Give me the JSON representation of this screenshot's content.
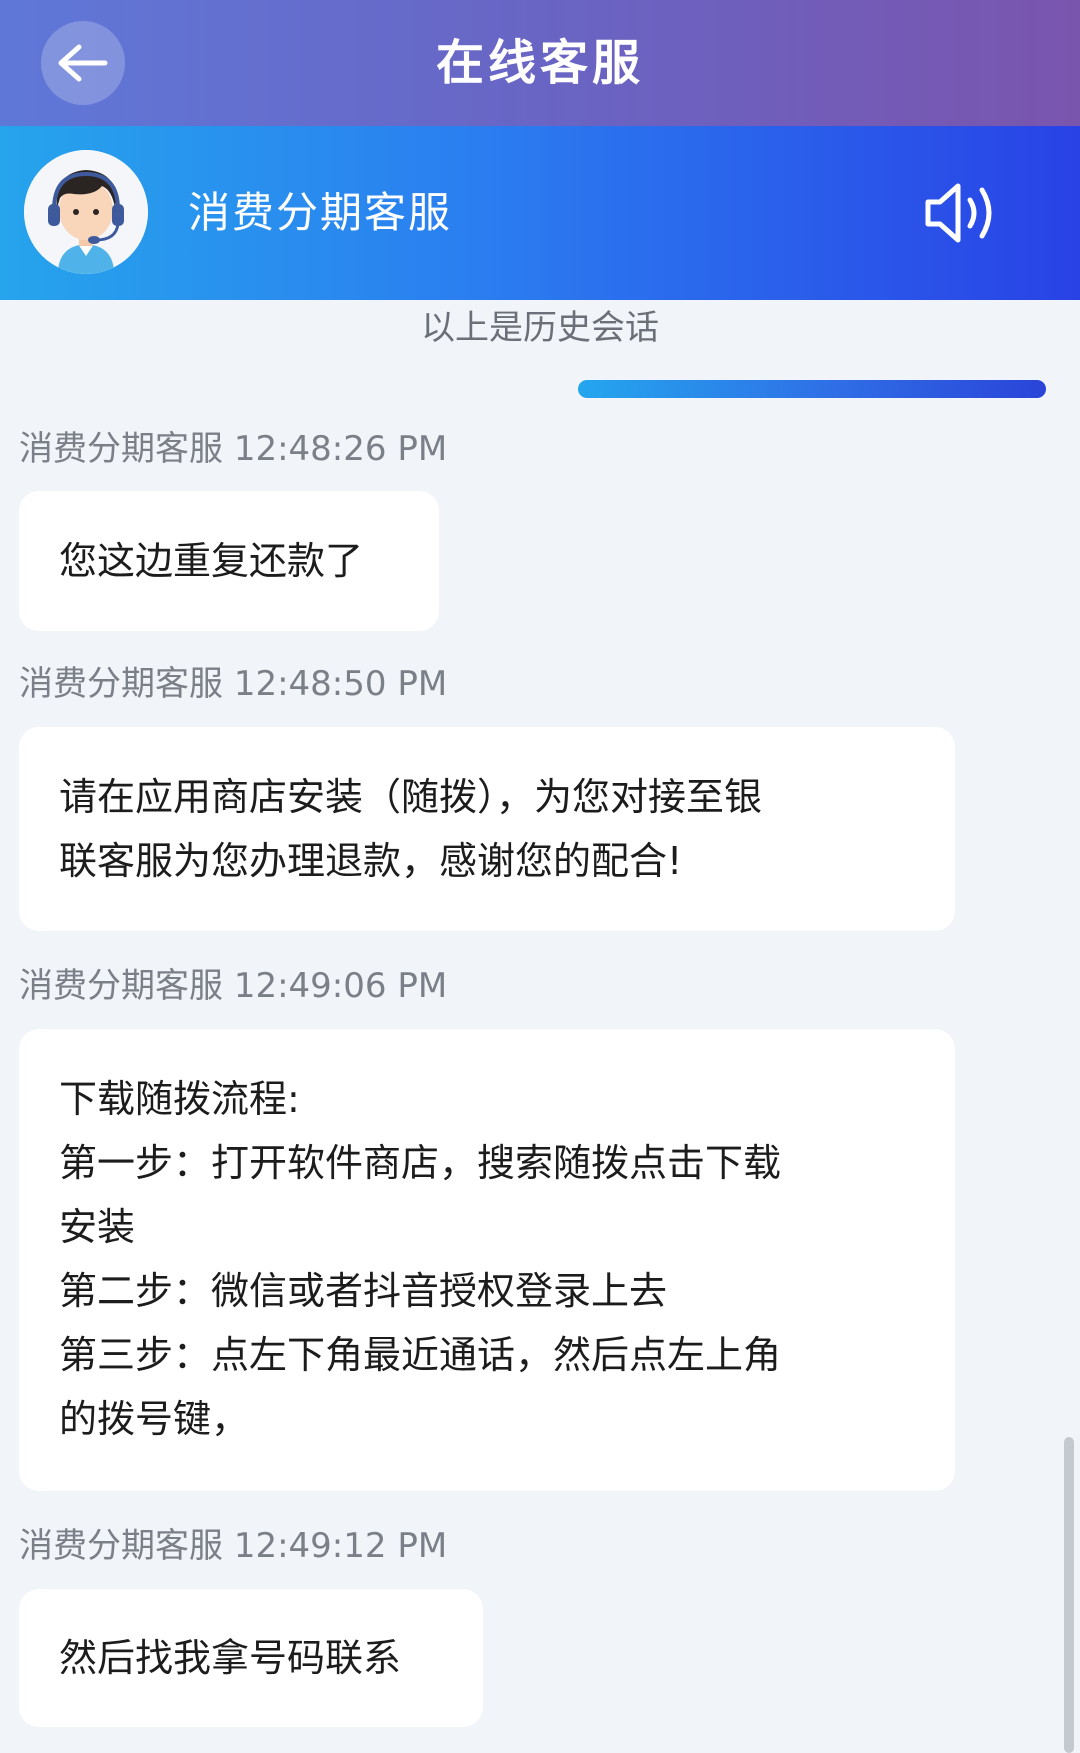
{
  "topbar": {
    "title": "在线客服",
    "back_icon": "back-arrow-icon"
  },
  "agent": {
    "name": "消费分期客服",
    "avatar_icon": "agent-headset-avatar",
    "sound_icon": "speaker-icon"
  },
  "history_note": "以上是历史会话",
  "messages": [
    {
      "sender": "消费分期客服",
      "time": "12:48:26 PM",
      "lines": [
        "您这边重复还款了"
      ]
    },
    {
      "sender": "消费分期客服",
      "time": "12:48:50 PM",
      "lines": [
        "请在应用商店安装（随拨），为您对接至银",
        "联客服为您办理退款，感谢您的配合!"
      ]
    },
    {
      "sender": "消费分期客服",
      "time": "12:49:06 PM",
      "lines": [
        "下载随拨流程:",
        "第一步：打开软件商店，搜索随拨点击下载",
        "安装",
        "第二步：微信或者抖音授权登录上去",
        "第三步：点左下角最近通话，然后点左上角",
        "的拨号键，"
      ]
    },
    {
      "sender": "消费分期客服",
      "time": "12:49:12 PM",
      "lines": [
        "然后找我拿号码联系"
      ]
    }
  ]
}
